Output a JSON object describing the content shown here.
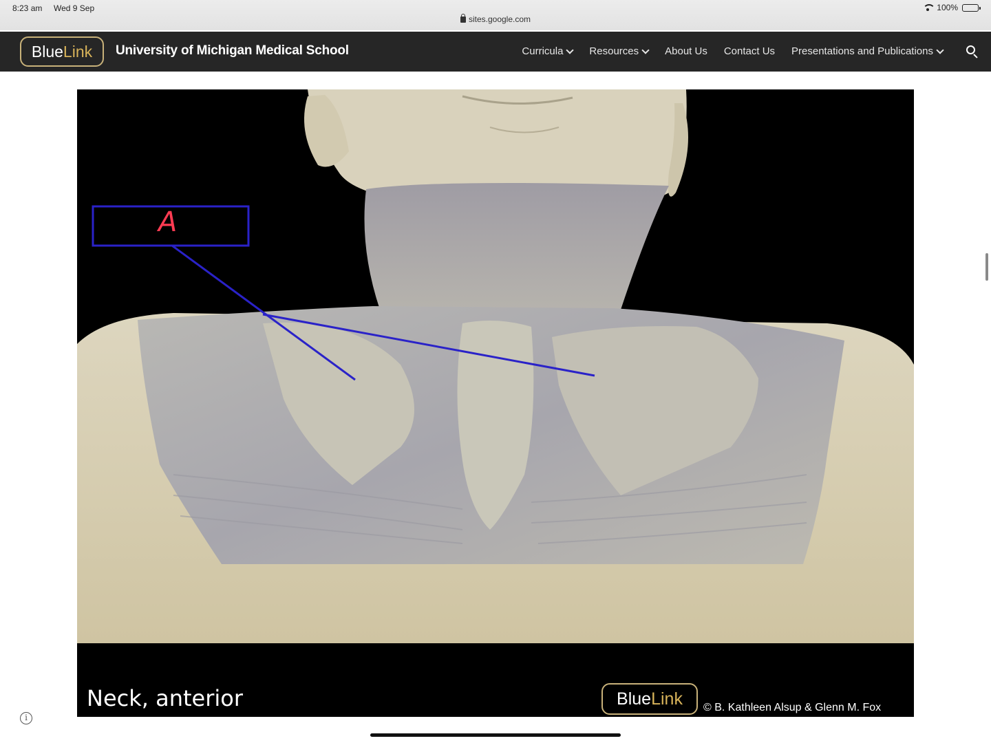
{
  "status_bar": {
    "time": "8:23 am",
    "date": "Wed 9 Sep",
    "url": "sites.google.com",
    "battery": "100%"
  },
  "header": {
    "logo_blue": "Blue",
    "logo_link": "Link",
    "site_title": "University of Michigan Medical School",
    "nav": [
      {
        "label": "Curricula",
        "has_dropdown": true
      },
      {
        "label": "Resources",
        "has_dropdown": true
      },
      {
        "label": "About Us",
        "has_dropdown": false
      },
      {
        "label": "Contact Us",
        "has_dropdown": false
      },
      {
        "label": "Presentations and Publications",
        "has_dropdown": true
      }
    ],
    "search_icon": "search-icon"
  },
  "figure": {
    "caption": "Neck, anterior",
    "watermark_blue": "Blue",
    "watermark_link": "Link",
    "copyright": "© B. Kathleen Alsup & Glenn M. Fox",
    "annotation_label": "A"
  },
  "colors": {
    "header_bg": "#262626",
    "logo_gold": "#d8b35a",
    "annotation_blue": "#2a22c8",
    "annotation_red": "#ff3b52"
  }
}
